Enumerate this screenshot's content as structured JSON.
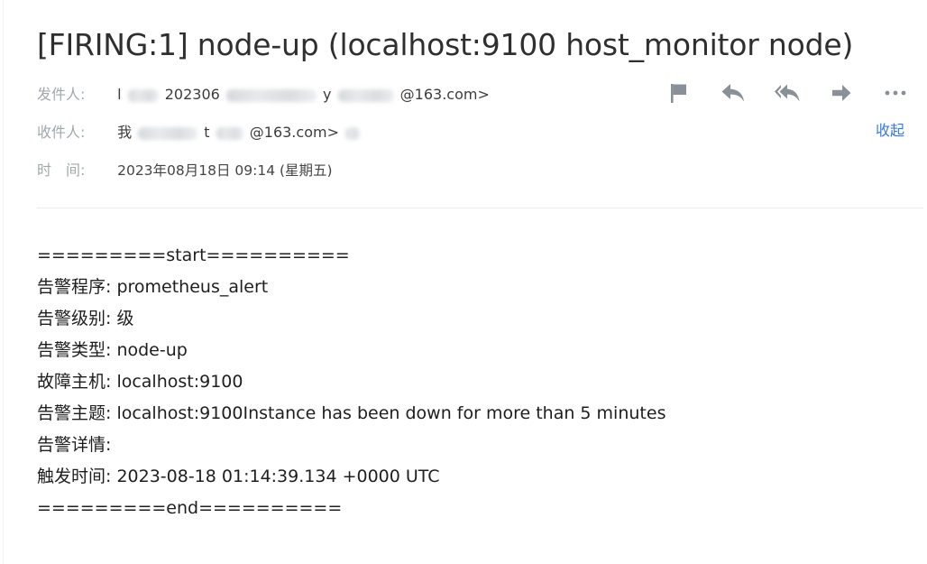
{
  "email": {
    "subject": "[FIRING:1] node-up (localhost:9100 host_monitor node)",
    "from_label": "发件人:",
    "from_value_start": "l",
    "from_value_mid": "202306",
    "from_value_mid2": "y",
    "from_value_end": "@163.com>",
    "to_label": "收件人:",
    "to_value_start": "我",
    "to_value_mid": "t",
    "to_value_end": "@163.com>",
    "time_label": "时　间:",
    "time_value": "2023年08月18日 09:14 (星期五)",
    "collapse_label": "收起"
  },
  "toolbar": {
    "icons": [
      "flag-icon",
      "reply-icon",
      "reply-all-icon",
      "forward-icon",
      "more-icon"
    ],
    "icon_color": "#8a9098"
  },
  "body": {
    "lines": [
      "=========start==========",
      "告警程序: prometheus_alert",
      "告警级别: 级",
      "告警类型: node-up",
      "故障主机: localhost:9100",
      "告警主题: localhost:9100Instance has been down for more than 5 minutes",
      "告警详情:",
      "触发时间: 2023-08-18 01:14:39.134 +0000 UTC",
      "=========end=========="
    ]
  },
  "colors": {
    "link": "#3a7ae0",
    "label": "#a3a8ae",
    "text": "#1e1e1e"
  }
}
